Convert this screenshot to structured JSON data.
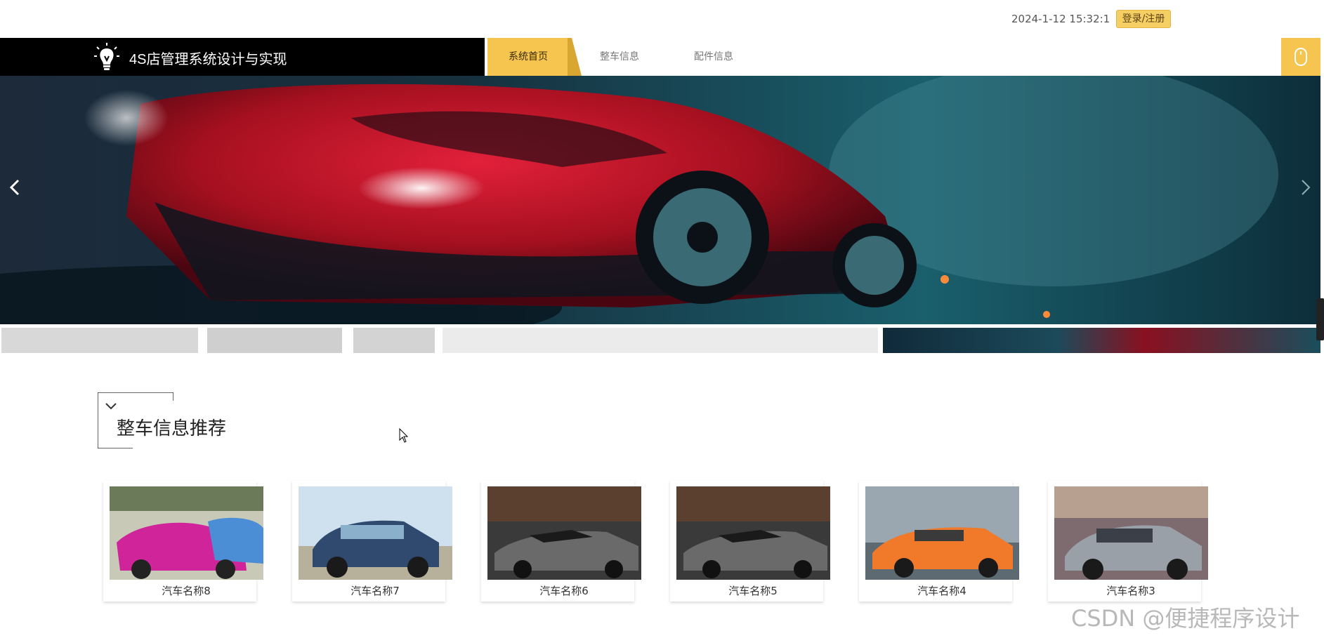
{
  "header": {
    "datetime": "2024-1-12 15:32:1",
    "login_label": "登录/注册"
  },
  "nav": {
    "site_title": "4S店管理系统设计与实现",
    "items": [
      {
        "label": "系统首页",
        "active": true
      },
      {
        "label": "整车信息",
        "active": false
      },
      {
        "label": "配件信息",
        "active": false
      }
    ]
  },
  "hero": {
    "prev_icon": "chevron-left-icon",
    "next_icon": "chevron-right-icon"
  },
  "section": {
    "title": "整车信息推荐"
  },
  "cards": [
    {
      "name": "汽车名称8"
    },
    {
      "name": "汽车名称7"
    },
    {
      "name": "汽车名称6"
    },
    {
      "name": "汽车名称5"
    },
    {
      "name": "汽车名称4"
    },
    {
      "name": "汽车名称3"
    }
  ],
  "watermark": "CSDN @便捷程序设计",
  "colors": {
    "accent": "#f5c54f",
    "navbar": "#000000"
  }
}
